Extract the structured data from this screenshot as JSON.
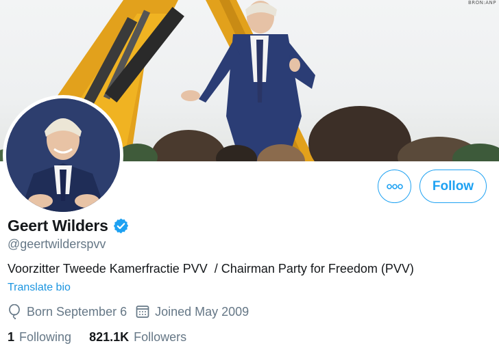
{
  "banner": {
    "watermark": "BRON:ANP"
  },
  "profile": {
    "display_name": "Geert Wilders",
    "verified": true,
    "handle": "@geertwilderspvv",
    "bio": "Voorzitter Tweede Kamerfractie PVV  / Chairman Party for Freedom (PVV)",
    "translate_label": "Translate bio",
    "born": "Born September 6",
    "joined": "Joined May 2009",
    "following_count": "1",
    "following_label": "Following",
    "followers_count": "821.1K",
    "followers_label": "Followers"
  },
  "actions": {
    "follow_label": "Follow",
    "more_icon": "more-horizontal-icon"
  },
  "colors": {
    "accent": "#1da1f2",
    "secondary_text": "#657786",
    "avatar_bg": "#2d3e6e"
  }
}
